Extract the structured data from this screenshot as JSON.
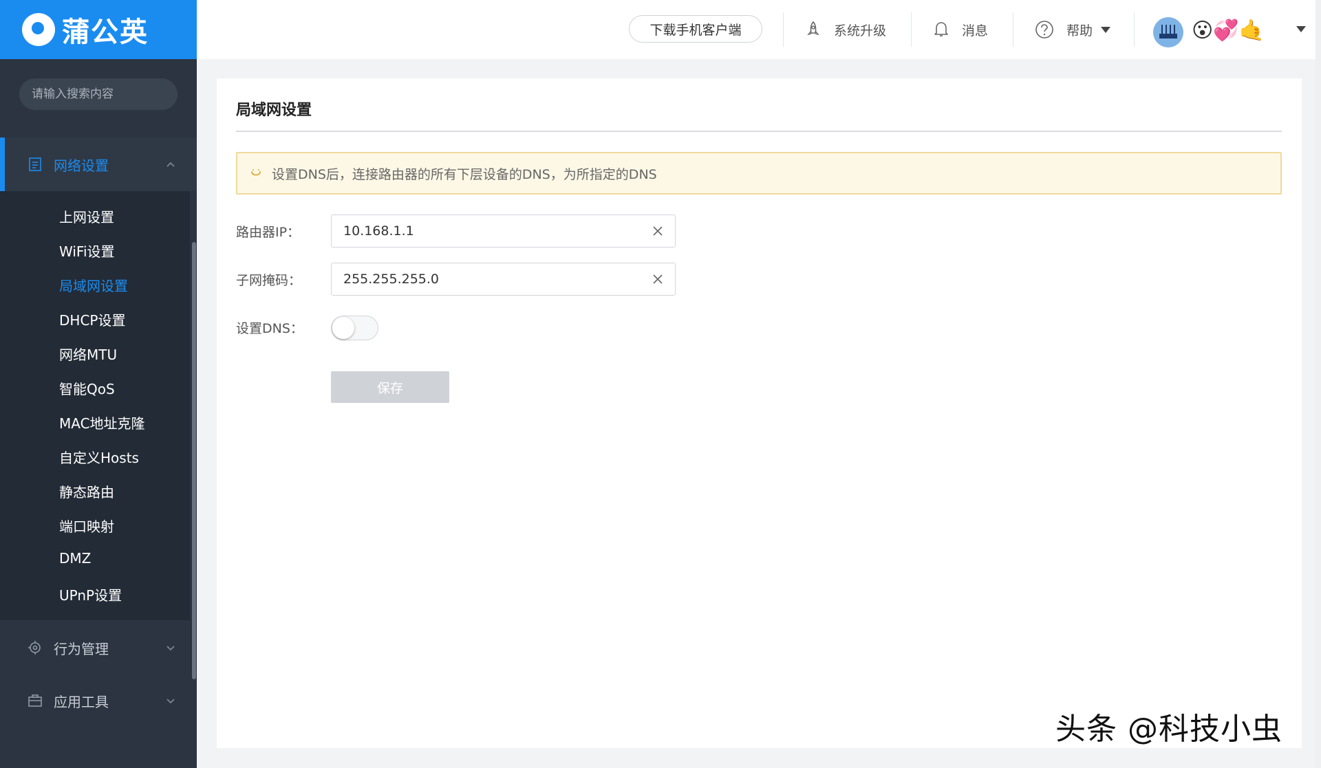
{
  "brand": {
    "name": "蒲公英",
    "color": "#1a8cf0"
  },
  "search": {
    "placeholder": "请输入搜索内容"
  },
  "sidebar": {
    "groups": [
      {
        "label": "网络设置",
        "icon": "list-doc-icon",
        "expanded": true
      },
      {
        "label": "行为管理",
        "icon": "gear-target-icon",
        "expanded": false
      },
      {
        "label": "应用工具",
        "icon": "briefcase-icon",
        "expanded": false
      }
    ],
    "items": [
      {
        "label": "上网设置"
      },
      {
        "label": "WiFi设置"
      },
      {
        "label": "局域网设置",
        "active": true
      },
      {
        "label": "DHCP设置"
      },
      {
        "label": "网络MTU"
      },
      {
        "label": "智能QoS"
      },
      {
        "label": "MAC地址克隆"
      },
      {
        "label": "自定义Hosts"
      },
      {
        "label": "静态路由"
      },
      {
        "label": "端口映射"
      },
      {
        "label": "DMZ"
      },
      {
        "label": "UPnP设置"
      }
    ]
  },
  "header": {
    "download_label": "下载手机客户端",
    "upgrade_label": "系统升级",
    "messages_label": "消息",
    "help_label": "帮助",
    "username": "😮💞🤙"
  },
  "page": {
    "title": "局域网设置",
    "notice": "设置DNS后，连接路由器的所有下层设备的DNS，为所指定的DNS",
    "fields": {
      "router_ip_label": "路由器IP：",
      "router_ip_value": "10.168.1.1",
      "subnet_label": "子网掩码：",
      "subnet_value": "255.255.255.0",
      "dns_label": "设置DNS：",
      "dns_enabled": false
    },
    "save_label": "保存"
  },
  "watermark": "头条 @科技小虫"
}
